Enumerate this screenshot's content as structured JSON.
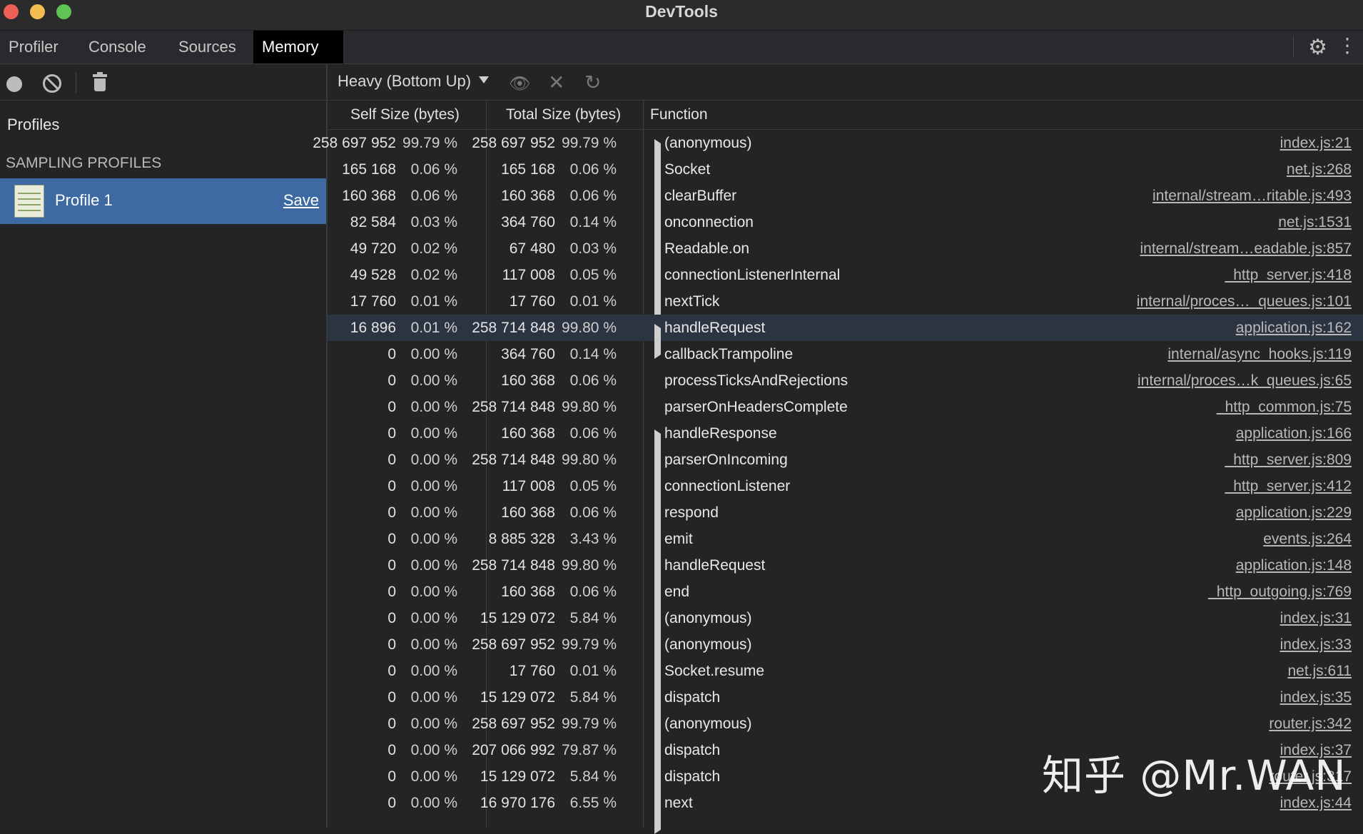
{
  "window": {
    "title": "DevTools"
  },
  "tabs": [
    {
      "label": "Profiler"
    },
    {
      "label": "Console"
    },
    {
      "label": "Sources"
    },
    {
      "label": "Memory",
      "active": true
    }
  ],
  "sidebar": {
    "profiles_heading": "Profiles",
    "section_heading": "SAMPLING PROFILES",
    "profile": {
      "name": "Profile 1",
      "save_label": "Save"
    }
  },
  "toolbar": {
    "view_mode": "Heavy (Bottom Up)"
  },
  "grid": {
    "headers": {
      "self": "Self Size (bytes)",
      "total": "Total Size (bytes)",
      "function": "Function"
    },
    "rows": [
      {
        "self": "258 697 952",
        "self_pct": "99.79 %",
        "total": "258 697 952",
        "total_pct": "99.79 %",
        "expandable": true,
        "func": "(anonymous)",
        "link": "index.js:21"
      },
      {
        "self": "165 168",
        "self_pct": "0.06 %",
        "total": "165 168",
        "total_pct": "0.06 %",
        "expandable": true,
        "func": "Socket",
        "link": "net.js:268"
      },
      {
        "self": "160 368",
        "self_pct": "0.06 %",
        "total": "160 368",
        "total_pct": "0.06 %",
        "expandable": true,
        "func": "clearBuffer",
        "link": "internal/stream…ritable.js:493"
      },
      {
        "self": "82 584",
        "self_pct": "0.03 %",
        "total": "364 760",
        "total_pct": "0.14 %",
        "expandable": true,
        "func": "onconnection",
        "link": "net.js:1531"
      },
      {
        "self": "49 720",
        "self_pct": "0.02 %",
        "total": "67 480",
        "total_pct": "0.03 %",
        "expandable": true,
        "func": "Readable.on",
        "link": "internal/stream…eadable.js:857"
      },
      {
        "self": "49 528",
        "self_pct": "0.02 %",
        "total": "117 008",
        "total_pct": "0.05 %",
        "expandable": true,
        "func": "connectionListenerInternal",
        "link": "_http_server.js:418"
      },
      {
        "self": "17 760",
        "self_pct": "0.01 %",
        "total": "17 760",
        "total_pct": "0.01 %",
        "expandable": true,
        "func": "nextTick",
        "link": "internal/proces…_queues.js:101"
      },
      {
        "self": "16 896",
        "self_pct": "0.01 %",
        "total": "258 714 848",
        "total_pct": "99.80 %",
        "expandable": true,
        "func": "handleRequest",
        "link": "application.js:162",
        "highlight": true
      },
      {
        "self": "0",
        "self_pct": "0.00 %",
        "total": "364 760",
        "total_pct": "0.14 %",
        "expandable": false,
        "func": "callbackTrampoline",
        "link": "internal/async_hooks.js:119"
      },
      {
        "self": "0",
        "self_pct": "0.00 %",
        "total": "160 368",
        "total_pct": "0.06 %",
        "expandable": false,
        "func": "processTicksAndRejections",
        "link": "internal/proces…k_queues.js:65"
      },
      {
        "self": "0",
        "self_pct": "0.00 %",
        "total": "258 714 848",
        "total_pct": "99.80 %",
        "expandable": false,
        "func": "parserOnHeadersComplete",
        "link": "_http_common.js:75"
      },
      {
        "self": "0",
        "self_pct": "0.00 %",
        "total": "160 368",
        "total_pct": "0.06 %",
        "expandable": true,
        "func": "handleResponse",
        "link": "application.js:166"
      },
      {
        "self": "0",
        "self_pct": "0.00 %",
        "total": "258 714 848",
        "total_pct": "99.80 %",
        "expandable": true,
        "func": "parserOnIncoming",
        "link": "_http_server.js:809"
      },
      {
        "self": "0",
        "self_pct": "0.00 %",
        "total": "117 008",
        "total_pct": "0.05 %",
        "expandable": true,
        "func": "connectionListener",
        "link": "_http_server.js:412"
      },
      {
        "self": "0",
        "self_pct": "0.00 %",
        "total": "160 368",
        "total_pct": "0.06 %",
        "expandable": true,
        "func": "respond",
        "link": "application.js:229"
      },
      {
        "self": "0",
        "self_pct": "0.00 %",
        "total": "8 885 328",
        "total_pct": "3.43 %",
        "expandable": true,
        "func": "emit",
        "link": "events.js:264"
      },
      {
        "self": "0",
        "self_pct": "0.00 %",
        "total": "258 714 848",
        "total_pct": "99.80 %",
        "expandable": true,
        "func": "handleRequest",
        "link": "application.js:148"
      },
      {
        "self": "0",
        "self_pct": "0.00 %",
        "total": "160 368",
        "total_pct": "0.06 %",
        "expandable": true,
        "func": "end",
        "link": "_http_outgoing.js:769"
      },
      {
        "self": "0",
        "self_pct": "0.00 %",
        "total": "15 129 072",
        "total_pct": "5.84 %",
        "expandable": true,
        "func": "(anonymous)",
        "link": "index.js:31"
      },
      {
        "self": "0",
        "self_pct": "0.00 %",
        "total": "258 697 952",
        "total_pct": "99.79 %",
        "expandable": true,
        "func": "(anonymous)",
        "link": "index.js:33"
      },
      {
        "self": "0",
        "self_pct": "0.00 %",
        "total": "17 760",
        "total_pct": "0.01 %",
        "expandable": true,
        "func": "Socket.resume",
        "link": "net.js:611"
      },
      {
        "self": "0",
        "self_pct": "0.00 %",
        "total": "15 129 072",
        "total_pct": "5.84 %",
        "expandable": true,
        "func": "dispatch",
        "link": "index.js:35"
      },
      {
        "self": "0",
        "self_pct": "0.00 %",
        "total": "258 697 952",
        "total_pct": "99.79 %",
        "expandable": true,
        "func": "(anonymous)",
        "link": "router.js:342"
      },
      {
        "self": "0",
        "self_pct": "0.00 %",
        "total": "207 066 992",
        "total_pct": "79.87 %",
        "expandable": true,
        "func": "dispatch",
        "link": "index.js:37"
      },
      {
        "self": "0",
        "self_pct": "0.00 %",
        "total": "15 129 072",
        "total_pct": "5.84 %",
        "expandable": true,
        "func": "dispatch",
        "link": "router.js:317"
      },
      {
        "self": "0",
        "self_pct": "0.00 %",
        "total": "16 970 176",
        "total_pct": "6.55 %",
        "expandable": true,
        "func": "next",
        "link": "index.js:44"
      }
    ]
  },
  "watermark": "知乎 @Mr.WAN"
}
